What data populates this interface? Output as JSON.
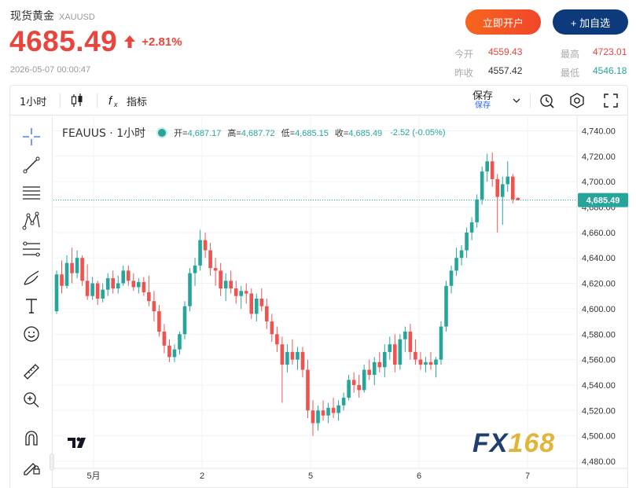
{
  "header": {
    "title": "现货黄金",
    "symbol": "XAUUSD",
    "price": "4685.49",
    "change_pct": "+2.81%",
    "datetime": "2026-05-07 00:00:47",
    "open_account_label": "立即开户",
    "watchlist_label": "+ 加自选"
  },
  "stats": {
    "today_open_label": "今开",
    "today_open": "4559.43",
    "high_label": "最高",
    "high": "4723.01",
    "prev_close_label": "昨收",
    "prev_close": "4557.42",
    "low_label": "最低",
    "low": "4546.18"
  },
  "toolbar": {
    "interval_label": "1小时",
    "indicators_label": "指标",
    "save_label": "保存",
    "save_sub_label": "保存"
  },
  "legend": {
    "symbol": "FEAUUS · 1小时",
    "open_label": "开=",
    "open": "4,687.17",
    "high_label": "高=",
    "high": "4,687.72",
    "low_label": "低=",
    "low": "4,685.15",
    "close_label": "收=",
    "close": "4,685.49",
    "change": "-2.52 (-0.05%)"
  },
  "watermark": {
    "brand_text": "FX",
    "brand_num": "168"
  },
  "colors": {
    "up": "#26a69a",
    "down": "#ef5350",
    "accent_red": "#e8453c",
    "navy": "#0d3a7a"
  },
  "chart_data": {
    "type": "candlestick",
    "title": "FEAUUS · 1小时",
    "ylim": [
      4480,
      4750
    ],
    "y_ticks": [
      "4,740.00",
      "4,720.00",
      "4,700.00",
      "4,680.00",
      "4,660.00",
      "4,640.00",
      "4,620.00",
      "4,600.00",
      "4,580.00",
      "4,560.00",
      "4,540.00",
      "4,520.00",
      "4,500.00",
      "4,480.00"
    ],
    "x_ticks": [
      "5月",
      "2",
      "5",
      "6",
      "7"
    ],
    "last_price_label": "4,685.49",
    "last_price": 4685.49,
    "candles": [
      [
        4598,
        4630,
        4596,
        4627
      ],
      [
        4627,
        4638,
        4612,
        4618
      ],
      [
        4618,
        4642,
        4616,
        4636
      ],
      [
        4636,
        4648,
        4620,
        4628
      ],
      [
        4628,
        4646,
        4624,
        4640
      ],
      [
        4640,
        4642,
        4618,
        4622
      ],
      [
        4622,
        4635,
        4607,
        4610
      ],
      [
        4610,
        4625,
        4607,
        4620
      ],
      [
        4620,
        4622,
        4603,
        4608
      ],
      [
        4608,
        4620,
        4605,
        4615
      ],
      [
        4615,
        4628,
        4610,
        4624
      ],
      [
        4624,
        4630,
        4612,
        4616
      ],
      [
        4616,
        4626,
        4612,
        4620
      ],
      [
        4620,
        4634,
        4618,
        4630
      ],
      [
        4630,
        4634,
        4618,
        4622
      ],
      [
        4622,
        4628,
        4614,
        4617
      ],
      [
        4617,
        4624,
        4612,
        4621
      ],
      [
        4621,
        4625,
        4610,
        4613
      ],
      [
        4613,
        4626,
        4602,
        4606
      ],
      [
        4606,
        4614,
        4590,
        4598
      ],
      [
        4598,
        4603,
        4578,
        4582
      ],
      [
        4582,
        4588,
        4565,
        4571
      ],
      [
        4571,
        4576,
        4558,
        4562
      ],
      [
        4562,
        4572,
        4558,
        4568
      ],
      [
        4568,
        4582,
        4564,
        4580
      ],
      [
        4580,
        4606,
        4576,
        4602
      ],
      [
        4602,
        4632,
        4598,
        4628
      ],
      [
        4628,
        4640,
        4618,
        4634
      ],
      [
        4634,
        4662,
        4630,
        4654
      ],
      [
        4654,
        4660,
        4640,
        4646
      ],
      [
        4646,
        4652,
        4626,
        4632
      ],
      [
        4632,
        4640,
        4618,
        4630
      ],
      [
        4630,
        4636,
        4610,
        4616
      ],
      [
        4616,
        4628,
        4606,
        4622
      ],
      [
        4622,
        4630,
        4612,
        4616
      ],
      [
        4616,
        4622,
        4604,
        4610
      ],
      [
        4610,
        4618,
        4600,
        4614
      ],
      [
        4614,
        4620,
        4604,
        4612
      ],
      [
        4612,
        4616,
        4592,
        4596
      ],
      [
        4596,
        4612,
        4590,
        4608
      ],
      [
        4608,
        4616,
        4598,
        4602
      ],
      [
        4602,
        4608,
        4584,
        4590
      ],
      [
        4590,
        4596,
        4574,
        4580
      ],
      [
        4580,
        4586,
        4566,
        4572
      ],
      [
        4572,
        4578,
        4526,
        4556
      ],
      [
        4556,
        4572,
        4550,
        4566
      ],
      [
        4566,
        4576,
        4556,
        4560
      ],
      [
        4560,
        4570,
        4552,
        4566
      ],
      [
        4566,
        4570,
        4546,
        4552
      ],
      [
        4552,
        4560,
        4514,
        4520
      ],
      [
        4520,
        4528,
        4500,
        4510
      ],
      [
        4510,
        4524,
        4504,
        4520
      ],
      [
        4520,
        4528,
        4512,
        4516
      ],
      [
        4516,
        4526,
        4510,
        4522
      ],
      [
        4522,
        4530,
        4514,
        4518
      ],
      [
        4518,
        4528,
        4512,
        4524
      ],
      [
        4524,
        4534,
        4520,
        4530
      ],
      [
        4530,
        4548,
        4528,
        4544
      ],
      [
        4544,
        4550,
        4534,
        4540
      ],
      [
        4540,
        4548,
        4530,
        4536
      ],
      [
        4536,
        4556,
        4534,
        4552
      ],
      [
        4552,
        4560,
        4544,
        4548
      ],
      [
        4548,
        4562,
        4540,
        4558
      ],
      [
        4558,
        4566,
        4550,
        4554
      ],
      [
        4554,
        4572,
        4546,
        4566
      ],
      [
        4566,
        4578,
        4560,
        4572
      ],
      [
        4572,
        4580,
        4550,
        4556
      ],
      [
        4556,
        4580,
        4552,
        4576
      ],
      [
        4576,
        4586,
        4566,
        4582
      ],
      [
        4582,
        4588,
        4560,
        4566
      ],
      [
        4566,
        4576,
        4556,
        4560
      ],
      [
        4560,
        4566,
        4552,
        4556
      ],
      [
        4556,
        4562,
        4550,
        4558
      ],
      [
        4558,
        4566,
        4552,
        4556
      ],
      [
        4556,
        4562,
        4546,
        4560
      ],
      [
        4560,
        4590,
        4556,
        4586
      ],
      [
        4586,
        4622,
        4582,
        4618
      ],
      [
        4618,
        4634,
        4612,
        4630
      ],
      [
        4630,
        4648,
        4626,
        4640
      ],
      [
        4640,
        4650,
        4634,
        4646
      ],
      [
        4646,
        4664,
        4640,
        4660
      ],
      [
        4660,
        4672,
        4654,
        4668
      ],
      [
        4668,
        4690,
        4664,
        4686
      ],
      [
        4686,
        4712,
        4682,
        4708
      ],
      [
        4708,
        4722,
        4700,
        4716
      ],
      [
        4716,
        4723,
        4696,
        4702
      ],
      [
        4702,
        4706,
        4660,
        4688
      ],
      [
        4688,
        4704,
        4666,
        4698
      ],
      [
        4698,
        4716,
        4692,
        4704
      ],
      [
        4704,
        4706,
        4683,
        4686
      ],
      [
        4687.17,
        4687.72,
        4685.15,
        4685.49
      ]
    ]
  }
}
